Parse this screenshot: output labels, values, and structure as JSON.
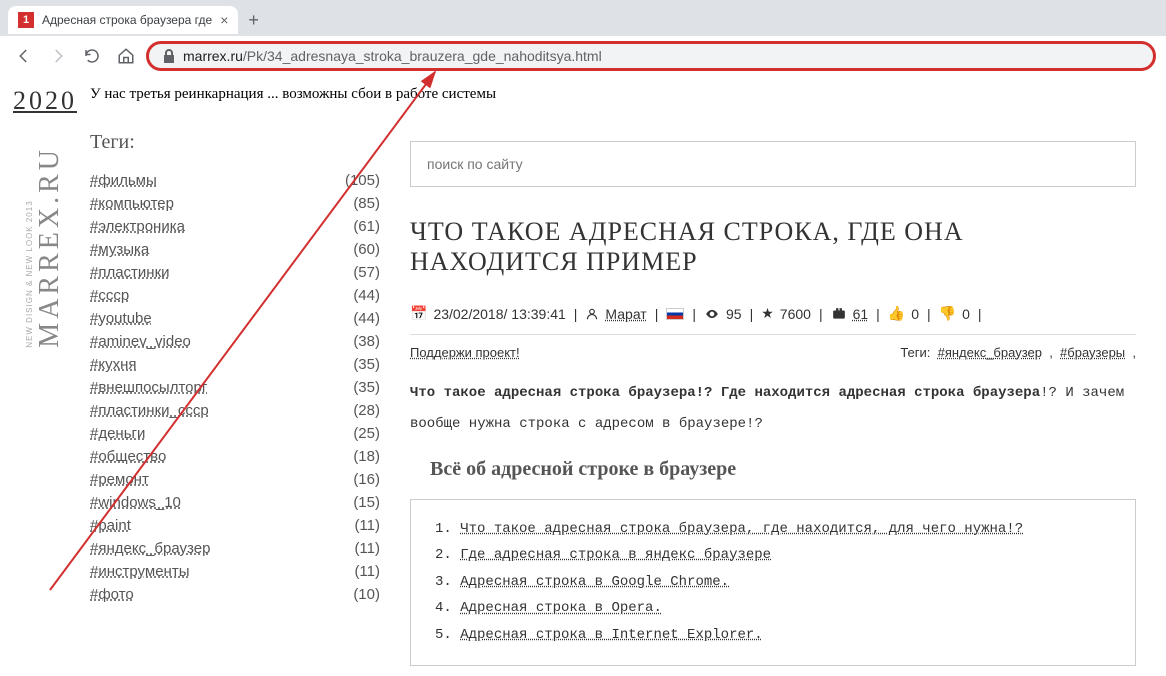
{
  "browser": {
    "tab_title": "Адресная строка браузера где",
    "url_domain": "marrex.ru",
    "url_path": "/Pk/34_adresnaya_stroka_brauzera_gde_nahoditsya.html"
  },
  "logo": {
    "year": "2020",
    "site": "MARREX.RU",
    "sub": "NEW DISIGN & NEW LOOK 2013"
  },
  "notice": "У нас третья реинкарнация ... возможны сбои в работе системы",
  "tags_title": "Теги:",
  "tags": [
    {
      "name": "#фильмы",
      "count": "(105)"
    },
    {
      "name": "#компьютер",
      "count": "(85)"
    },
    {
      "name": "#электроника",
      "count": "(61)"
    },
    {
      "name": "#музыка",
      "count": "(60)"
    },
    {
      "name": "#пластинки",
      "count": "(57)"
    },
    {
      "name": "#ссср",
      "count": "(44)"
    },
    {
      "name": "#youtube",
      "count": "(44)"
    },
    {
      "name": "#aminev_video",
      "count": "(38)"
    },
    {
      "name": "#кухня",
      "count": "(35)"
    },
    {
      "name": "#внешпосылторг",
      "count": "(35)"
    },
    {
      "name": "#пластинки_ссср",
      "count": "(28)"
    },
    {
      "name": "#деньги",
      "count": "(25)"
    },
    {
      "name": "#общество",
      "count": "(18)"
    },
    {
      "name": "#ремонт",
      "count": "(16)"
    },
    {
      "name": "#windows_10",
      "count": "(15)"
    },
    {
      "name": "#paint",
      "count": "(11)"
    },
    {
      "name": "#яндекс_браузер",
      "count": "(11)"
    },
    {
      "name": "#инструменты",
      "count": "(11)"
    },
    {
      "name": "#фото",
      "count": "(10)"
    }
  ],
  "search_placeholder": "поиск по сайту",
  "article": {
    "title": "ЧТО ТАКОЕ АДРЕСНАЯ СТРОКА, ГДЕ ОНА НАХОДИТСЯ ПРИМЕР",
    "date": "23/02/2018/ 13:39:41",
    "author": "Марат",
    "views": "95",
    "stars": "7600",
    "video": "61",
    "likes": "0",
    "dislikes": "0",
    "support": "Поддержи проект!",
    "tags_label": "Теги:",
    "tag1": "#яндекс_браузер",
    "tag2": "#браузеры",
    "intro_bold": "Что такое адресная строка браузера!? Где находится адресная строка браузера",
    "intro_rest": "!? И зачем вообще нужна строка с адресом в браузере!?",
    "section_title": "Всё об адресной строке в браузере",
    "toc": [
      "Что такое адресная строка браузера, где находится, для чего нужна!?",
      "Где адресная строка в яндекс браузере",
      "Адресная строка в Google Chrome.",
      "Адресная строка в Opera.",
      "Адресная строка в Internet Explorer."
    ]
  }
}
